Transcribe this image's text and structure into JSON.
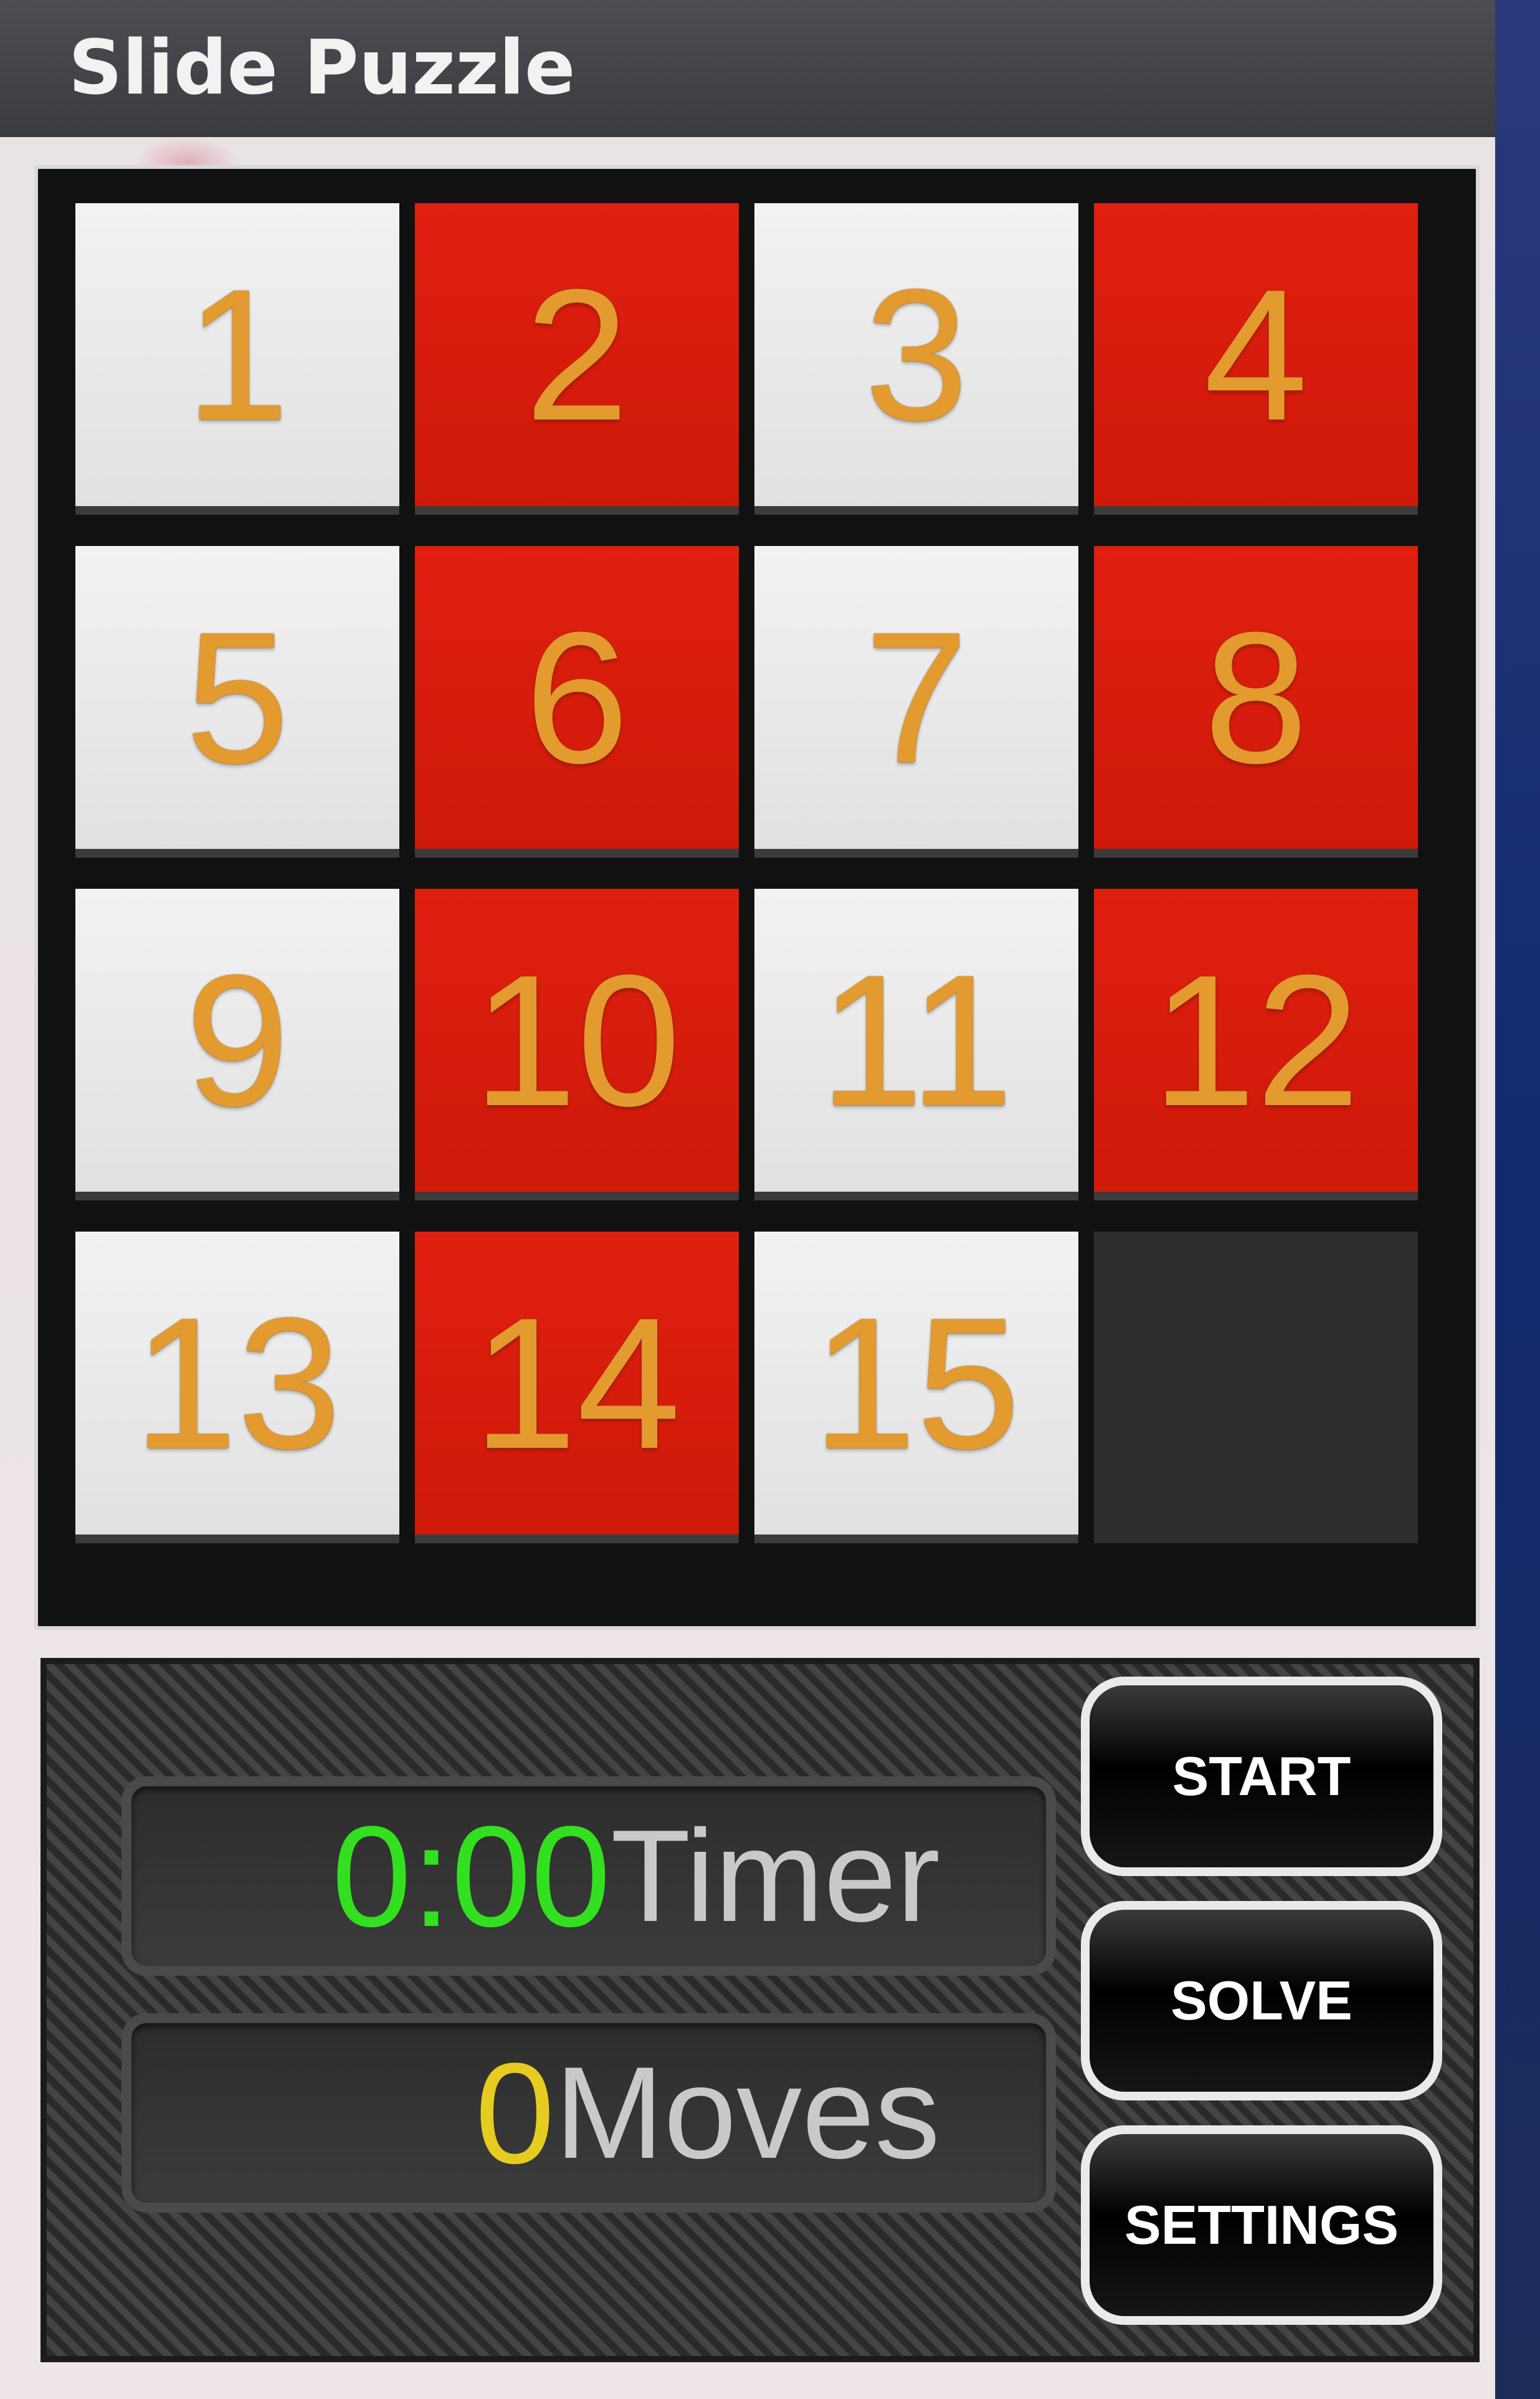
{
  "window": {
    "title": "Slide Puzzle"
  },
  "board": {
    "tiles": [
      {
        "label": "1",
        "color": "white"
      },
      {
        "label": "2",
        "color": "red"
      },
      {
        "label": "3",
        "color": "white"
      },
      {
        "label": "4",
        "color": "red"
      },
      {
        "label": "5",
        "color": "white"
      },
      {
        "label": "6",
        "color": "red"
      },
      {
        "label": "7",
        "color": "white"
      },
      {
        "label": "8",
        "color": "red"
      },
      {
        "label": "9",
        "color": "white"
      },
      {
        "label": "10",
        "color": "red"
      },
      {
        "label": "11",
        "color": "white"
      },
      {
        "label": "12",
        "color": "red"
      },
      {
        "label": "13",
        "color": "white"
      },
      {
        "label": "14",
        "color": "red"
      },
      {
        "label": "15",
        "color": "white"
      },
      {
        "label": "",
        "color": "empty"
      }
    ],
    "colors": {
      "red": "#e01f0e",
      "white": "#efefef",
      "number": "#e39a2f"
    }
  },
  "controls": {
    "timer": {
      "value": "0:00",
      "label": "Timer",
      "color": "#33e01f"
    },
    "moves": {
      "value": "0",
      "label": "Moves",
      "color": "#e6cc20"
    },
    "buttons": {
      "start": "START",
      "solve": "SOLVE",
      "settings": "SETTINGS"
    }
  }
}
